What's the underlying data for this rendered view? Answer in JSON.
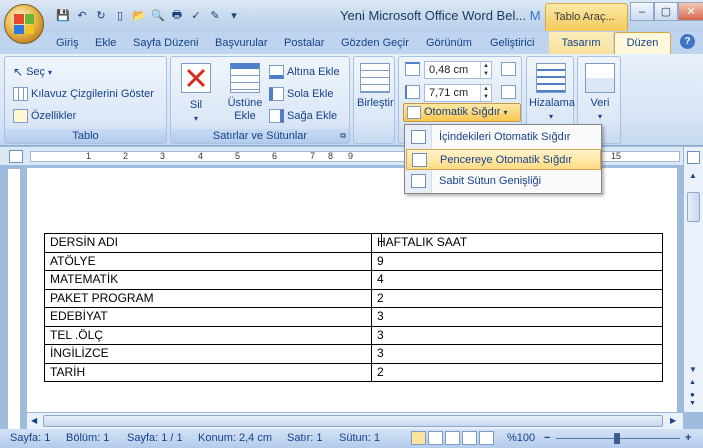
{
  "window": {
    "doc_title": "Yeni Microsoft Office Word Bel...",
    "doc_title_tail": "M",
    "tools_tab": "Tablo Araç...",
    "controls": {
      "minimize": "–",
      "maximize": "▢",
      "close": "✕"
    }
  },
  "tabs": [
    "Giriş",
    "Ekle",
    "Sayfa Düzeni",
    "Başvurular",
    "Postalar",
    "Gözden Geçir",
    "Görünüm",
    "Geliştirici"
  ],
  "contextual_tabs": {
    "design": "Tasarım",
    "layout": "Düzen"
  },
  "ribbon": {
    "table_group": {
      "label": "Tablo",
      "select": "Seç",
      "gridlines": "Kılavuz Çizgilerini Göster",
      "properties": "Özellikler"
    },
    "rows_cols_group": {
      "label": "Satırlar ve Sütunlar",
      "delete": "Sil",
      "insert_above": "Üstüne",
      "insert_above_2": "Ekle",
      "insert_below": "Altına Ekle",
      "insert_left": "Sola Ekle",
      "insert_right": "Sağa Ekle"
    },
    "merge": "Birleştir",
    "cell_size": {
      "height": "0,48 cm",
      "width": "7,71 cm",
      "autofit": "Otomatik Sığdır"
    },
    "alignment": "Hizalama",
    "data": "Veri"
  },
  "autofit_menu": [
    {
      "label": "İçindekileri Otomatik Sığdır",
      "highlighted": false
    },
    {
      "label": "Pencereye Otomatik Sığdır",
      "highlighted": true
    },
    {
      "label": "Sabit Sütun Genişliği",
      "highlighted": false
    }
  ],
  "ruler_numbers": [
    "1",
    "2",
    "3",
    "4",
    "5",
    "6",
    "7",
    "8",
    "9",
    "15"
  ],
  "table": {
    "rows": [
      [
        "DERSİN ADI",
        "HAFTALIK SAAT"
      ],
      [
        "ATÖLYE",
        "9"
      ],
      [
        "MATEMATİK",
        "4"
      ],
      [
        "PAKET PROGRAM",
        "2"
      ],
      [
        "EDEBİYAT",
        "3"
      ],
      [
        "TEL .ÖLÇ",
        "3"
      ],
      [
        "İNGİLİZCE",
        "3"
      ],
      [
        "TARİH",
        "2"
      ]
    ]
  },
  "status": {
    "page": "Sayfa: 1",
    "section": "Bölüm: 1",
    "pages": "Sayfa: 1 / 1",
    "position": "Konum: 2,4 cm",
    "line": "Satır: 1",
    "column": "Sütun: 1",
    "zoom": "%100"
  }
}
